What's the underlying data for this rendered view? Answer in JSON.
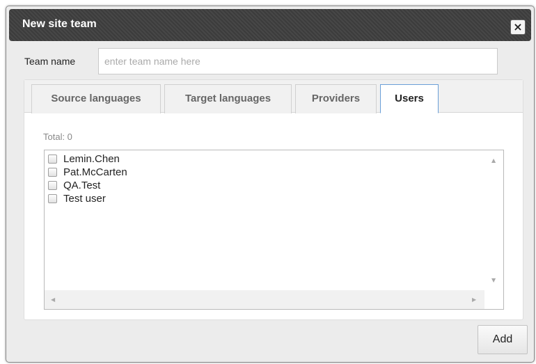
{
  "dialog": {
    "title": "New site team",
    "close_label": "×"
  },
  "team_name": {
    "label": "Team name",
    "placeholder": "enter team name here",
    "value": ""
  },
  "tabs": [
    {
      "label": "Source languages",
      "active": false
    },
    {
      "label": "Target languages",
      "active": false
    },
    {
      "label": "Providers",
      "active": false
    },
    {
      "label": "Users",
      "active": true
    }
  ],
  "users": {
    "total_label": "Total: 0",
    "items": [
      {
        "label": "Lemin.Chen",
        "checked": false
      },
      {
        "label": "Pat.McCarten",
        "checked": false
      },
      {
        "label": "QA.Test",
        "checked": false
      },
      {
        "label": "Test user",
        "checked": false
      }
    ]
  },
  "scroll_glyphs": {
    "up": "▲",
    "down": "▼",
    "left": "◀",
    "right": "▶"
  },
  "actions": {
    "add_label": "Add"
  },
  "icons": [
    "close-icon",
    "checkbox-icon",
    "scroll-up-icon",
    "scroll-down-icon",
    "scroll-left-icon",
    "scroll-right-icon"
  ],
  "colors": {
    "titlebar": "#3c3c3c",
    "active_tab_border": "#6a9fd8",
    "dialog_bg": "#ececec"
  }
}
